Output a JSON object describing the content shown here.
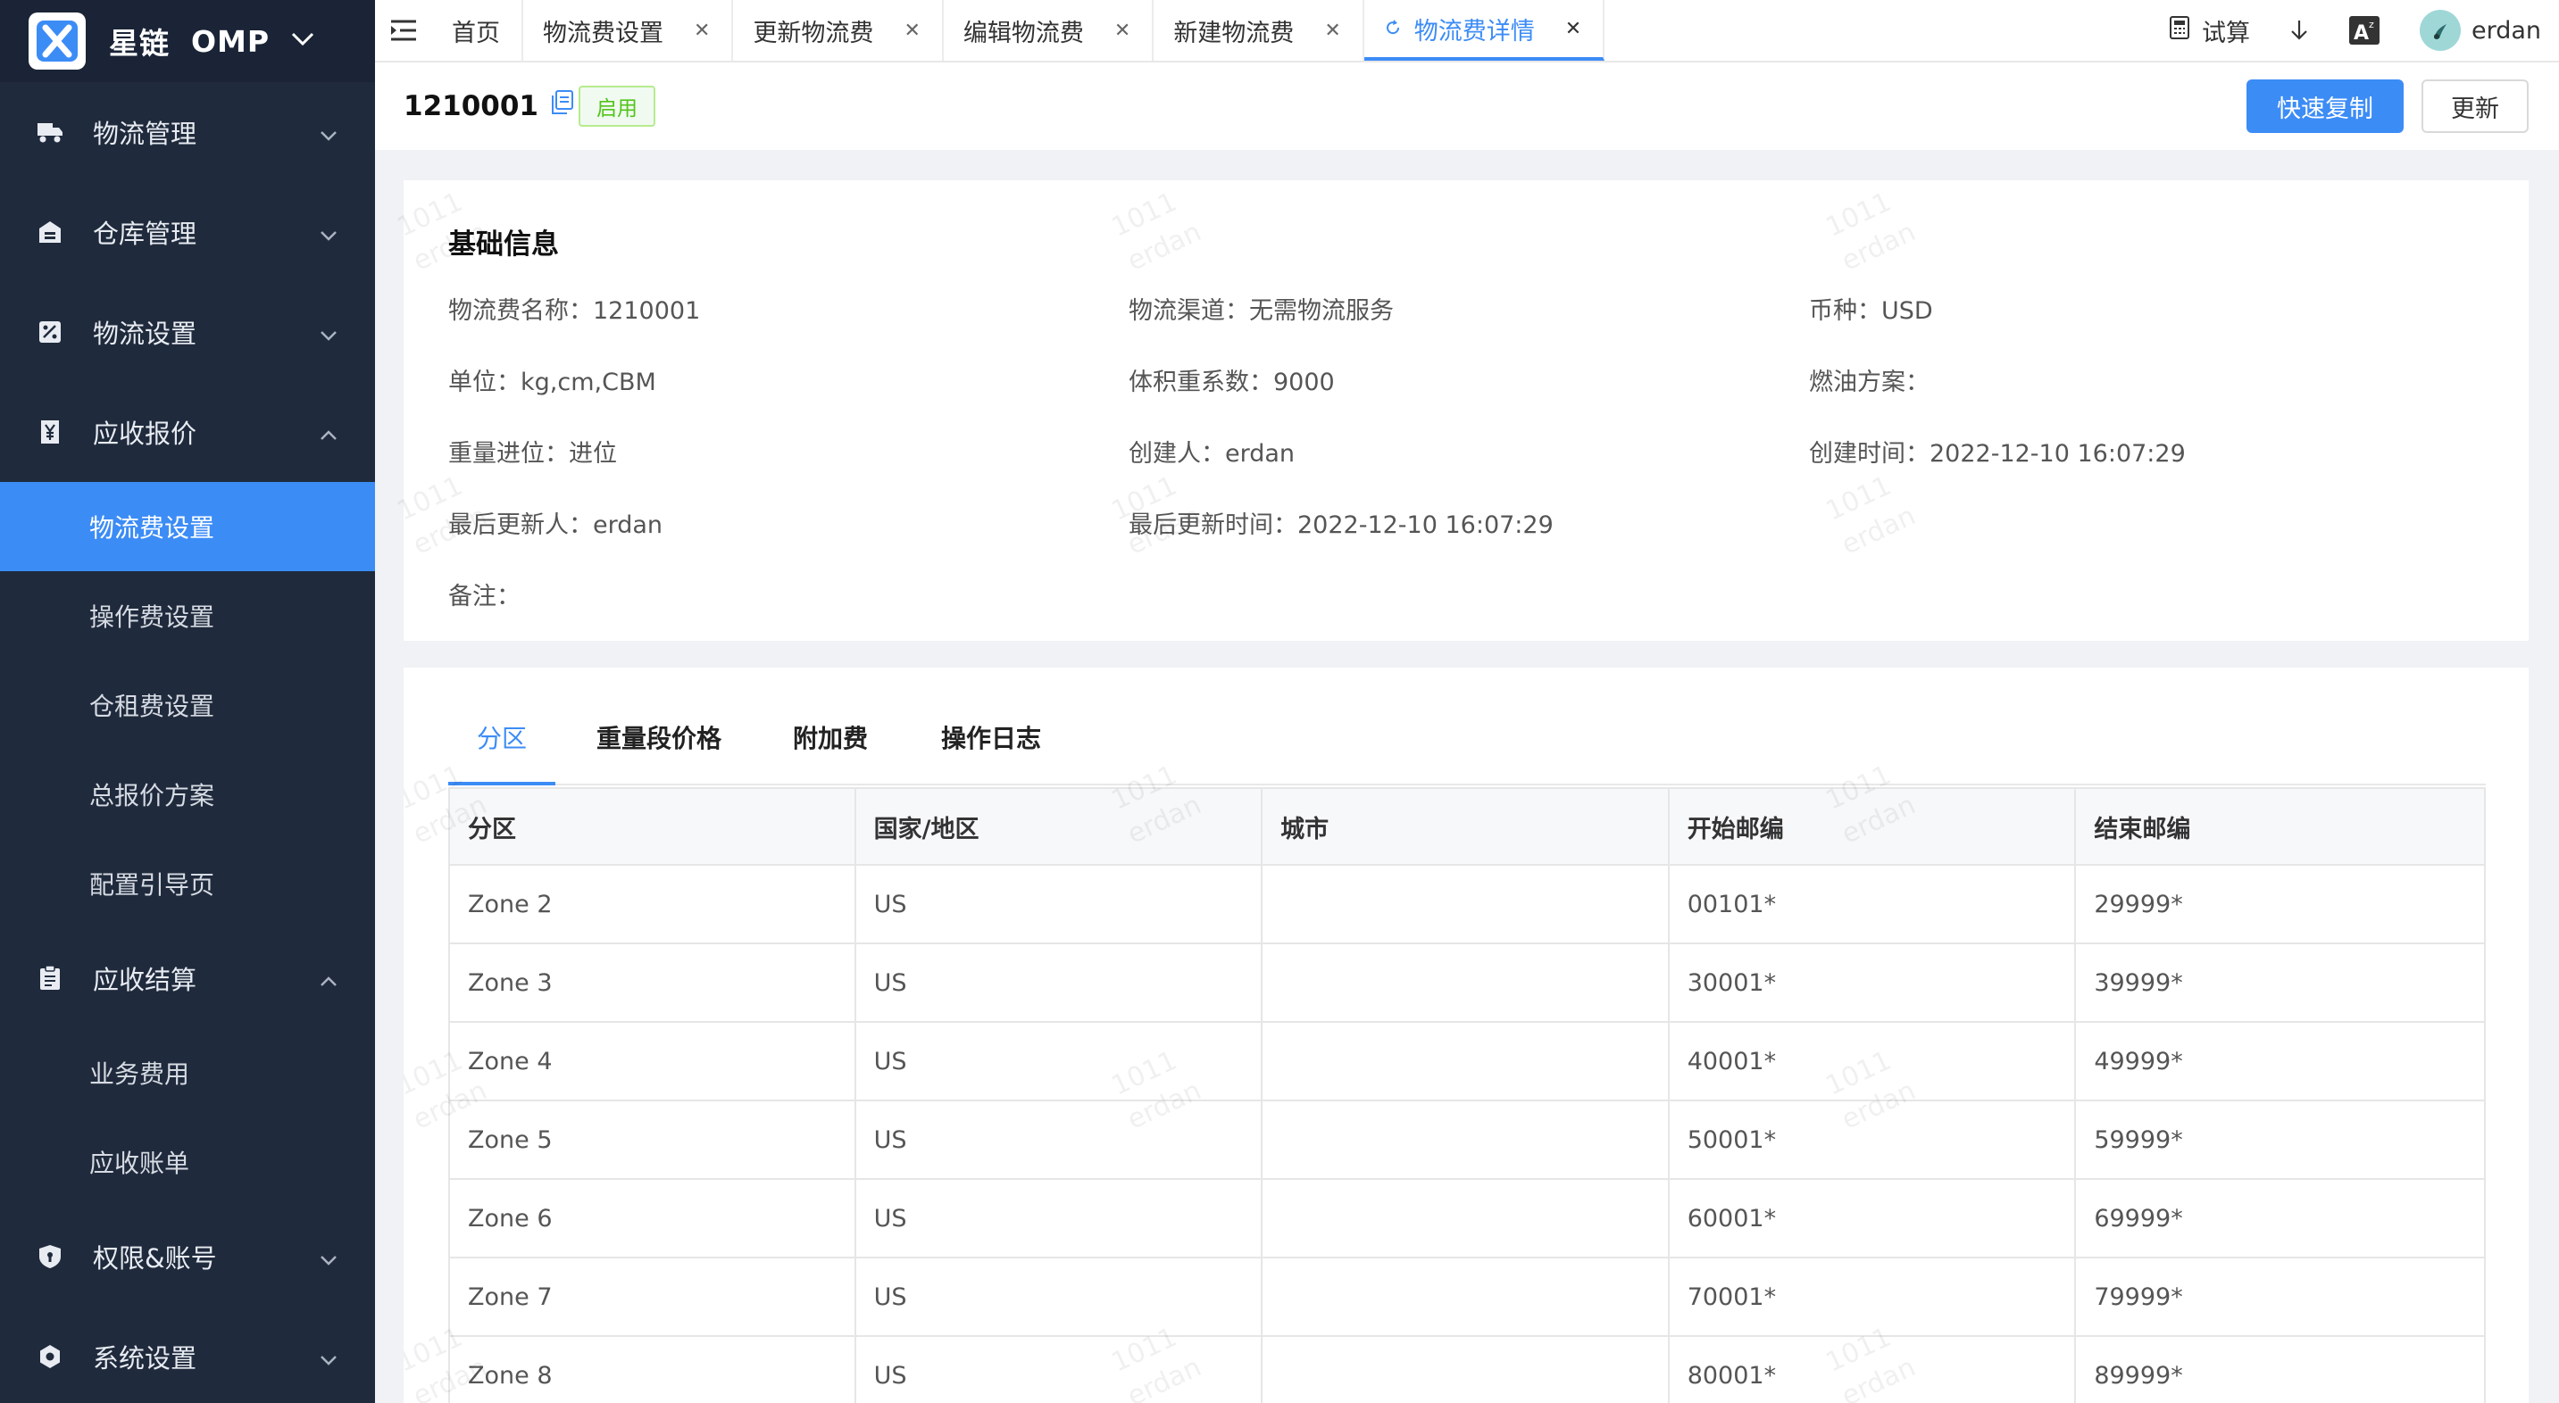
{
  "brand": {
    "name": "星链",
    "app": "OMP"
  },
  "sidebar": {
    "groups": [
      {
        "label": "物流管理",
        "icon": "truck-icon"
      },
      {
        "label": "仓库管理",
        "icon": "warehouse-icon"
      },
      {
        "label": "物流设置",
        "icon": "logistics-settings-icon"
      },
      {
        "label": "应收报价",
        "icon": "yen-icon",
        "children": [
          "物流费设置",
          "操作费设置",
          "仓租费设置",
          "总报价方案",
          "配置引导页"
        ]
      },
      {
        "label": "应收结算",
        "icon": "clipboard-icon",
        "children": [
          "业务费用",
          "应收账单"
        ]
      },
      {
        "label": "权限&账号",
        "icon": "shield-icon"
      },
      {
        "label": "系统设置",
        "icon": "gear-icon"
      }
    ]
  },
  "tabs": [
    "首页",
    "物流费设置",
    "更新物流费",
    "编辑物流费",
    "新建物流费",
    "物流费详情"
  ],
  "toolbar": {
    "trial": "试算",
    "user": "erdan"
  },
  "header": {
    "code": "1210001",
    "status": "启用",
    "copy_btn": "快速复制",
    "update_btn": "更新"
  },
  "basic": {
    "title": "基础信息",
    "fields": {
      "name": "物流费名称：1210001",
      "channel": "物流渠道：无需物流服务",
      "currency": "币种：USD",
      "unit": "单位：kg,cm,CBM",
      "vol": "体积重系数：9000",
      "fuel": "燃油方案：",
      "rounding": "重量进位：进位",
      "creator": "创建人：erdan",
      "created": "创建时间：2022-12-10 16:07:29",
      "updater": "最后更新人：erdan",
      "updated": "最后更新时间：2022-12-10 16:07:29",
      "remark": "备注："
    }
  },
  "zone_tabs": [
    "分区",
    "重量段价格",
    "附加费",
    "操作日志"
  ],
  "table": {
    "headers": [
      "分区",
      "国家/地区",
      "城市",
      "开始邮编",
      "结束邮编"
    ],
    "rows": [
      [
        "Zone 2",
        "US",
        "",
        "00101*",
        "29999*"
      ],
      [
        "Zone 3",
        "US",
        "",
        "30001*",
        "39999*"
      ],
      [
        "Zone 4",
        "US",
        "",
        "40001*",
        "49999*"
      ],
      [
        "Zone 5",
        "US",
        "",
        "50001*",
        "59999*"
      ],
      [
        "Zone 6",
        "US",
        "",
        "60001*",
        "69999*"
      ],
      [
        "Zone 7",
        "US",
        "",
        "70001*",
        "79999*"
      ],
      [
        "Zone 8",
        "US",
        "",
        "80001*",
        "89999*"
      ]
    ]
  },
  "watermark": {
    "line1": "1011",
    "line2": "erdan"
  },
  "colors": {
    "primary": "#3c8cf6",
    "sidebar": "#1f2a3c",
    "success": "#52c41a"
  }
}
